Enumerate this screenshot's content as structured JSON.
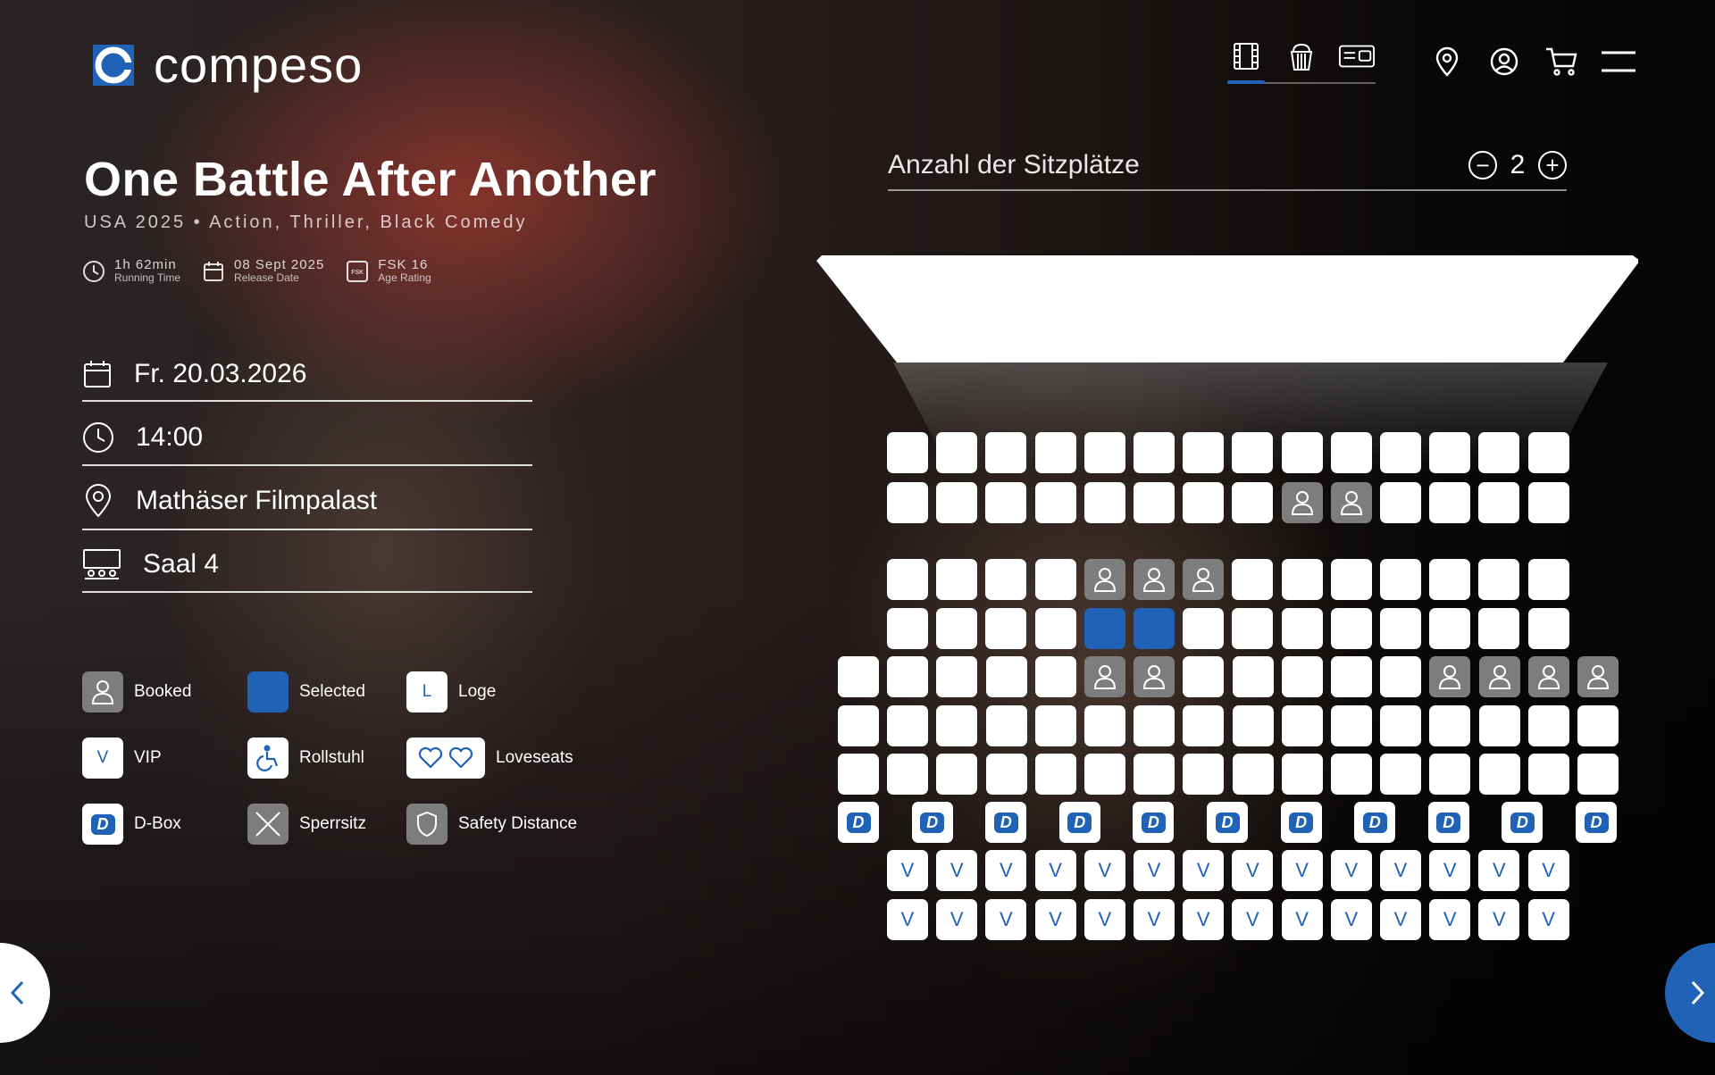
{
  "brand": {
    "name": "compeso",
    "color": "#1f62b6"
  },
  "nav": {
    "tabs": [
      {
        "icon": "film-icon",
        "active": true
      },
      {
        "icon": "popcorn-icon",
        "active": false
      },
      {
        "icon": "ticket-icon",
        "active": false
      }
    ],
    "icons": [
      "location-pin-icon",
      "user-icon",
      "cart-icon",
      "hamburger-menu-icon"
    ]
  },
  "movie": {
    "title": "One Battle After Another",
    "subtitle": "USA 2025 • Action, Thriller, Black Comedy",
    "running_time": "1h 62min",
    "running_time_label": "Running Time",
    "release_date": "08 Sept 2025",
    "release_date_label": "Release Date",
    "fsk_badge": "FSK",
    "age_rating": "FSK 16",
    "age_rating_label": "Age Rating"
  },
  "showing": {
    "date": "Fr. 20.03.2026",
    "time": "14:00",
    "cinema": "Mathäser Filmpalast",
    "hall": "Saal 4"
  },
  "legend": {
    "booked": "Booked",
    "selected": "Selected",
    "loge": "Loge",
    "loge_symbol": "L",
    "vip": "VIP",
    "vip_symbol": "V",
    "wheelchair": "Rollstuhl",
    "loveseats": "Loveseats",
    "dbox": "D-Box",
    "dbox_symbol": "D",
    "blocked": "Sperrsitz",
    "safety": "Safety Distance"
  },
  "seat_count": {
    "label": "Anzahl der Sitzplätze",
    "value": "2",
    "minus": "−",
    "plus": "+"
  },
  "colors": {
    "selected": "#1f62b6",
    "booked": "#7d7d7d",
    "free": "#ffffff"
  },
  "seat_map": {
    "rows": [
      {
        "type": "standard",
        "seats": [
          "free",
          "free",
          "free",
          "free",
          "free",
          "free",
          "free",
          "free",
          "free",
          "free",
          "free",
          "free",
          "free",
          "free"
        ]
      },
      {
        "type": "standard",
        "seats": [
          "free",
          "free",
          "free",
          "free",
          "free",
          "free",
          "free",
          "free",
          "booked",
          "booked",
          "free",
          "free",
          "free",
          "free"
        ]
      },
      {
        "type": "standard",
        "seats": [
          "free",
          "free",
          "free",
          "free",
          "booked",
          "booked",
          "booked",
          "free",
          "free",
          "free",
          "free",
          "free",
          "free",
          "free"
        ]
      },
      {
        "type": "standard",
        "seats": [
          "free",
          "free",
          "free",
          "free",
          "selected",
          "selected",
          "free",
          "free",
          "free",
          "free",
          "free",
          "free",
          "free",
          "free"
        ]
      },
      {
        "type": "standard",
        "seats": [
          "free",
          "free",
          "free",
          "free",
          "free",
          "booked",
          "booked",
          "free",
          "free",
          "free",
          "free",
          "free",
          "booked",
          "booked",
          "booked",
          "booked"
        ]
      },
      {
        "type": "standard",
        "seats": [
          "free",
          "free",
          "free",
          "free",
          "free",
          "free",
          "free",
          "free",
          "free",
          "free",
          "free",
          "free",
          "free",
          "free",
          "free",
          "free"
        ]
      },
      {
        "type": "standard",
        "seats": [
          "free",
          "free",
          "free",
          "free",
          "free",
          "free",
          "free",
          "free",
          "free",
          "free",
          "free",
          "free",
          "free",
          "free",
          "free",
          "free"
        ]
      },
      {
        "type": "dbox",
        "seats": [
          "dbox",
          "dbox",
          "dbox",
          "dbox",
          "dbox",
          "dbox",
          "dbox",
          "dbox",
          "dbox",
          "dbox",
          "dbox"
        ]
      },
      {
        "type": "vip",
        "seats": [
          "vip",
          "vip",
          "vip",
          "vip",
          "vip",
          "vip",
          "vip",
          "vip",
          "vip",
          "vip",
          "vip",
          "vip",
          "vip",
          "vip"
        ]
      },
      {
        "type": "vip",
        "seats": [
          "vip",
          "vip",
          "vip",
          "vip",
          "vip",
          "vip",
          "vip",
          "vip",
          "vip",
          "vip",
          "vip",
          "vip",
          "vip",
          "vip"
        ]
      }
    ]
  }
}
